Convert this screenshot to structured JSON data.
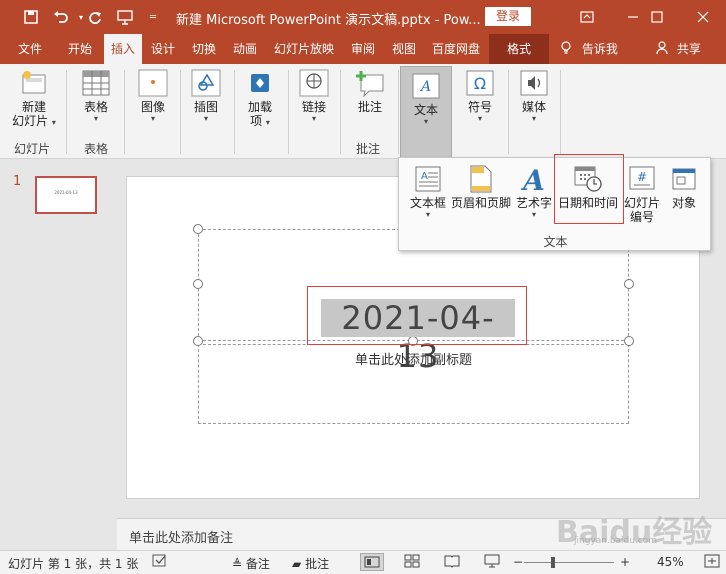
{
  "titlebar": {
    "title": "新建 Microsoft PowerPoint 演示文稿.pptx  -  Pow...",
    "login": "登录",
    "icons": [
      "save-icon",
      "undo-icon",
      "redo-icon",
      "presenter-icon",
      "customize-icon"
    ]
  },
  "menu": {
    "tabs": [
      "文件",
      "开始",
      "插入",
      "设计",
      "切换",
      "动画",
      "幻灯片放映",
      "审阅",
      "视图",
      "百度网盘",
      "格式"
    ],
    "active": "插入",
    "tell_me": "告诉我",
    "share": "共享"
  },
  "ribbon": {
    "new_slide_line1": "新建",
    "new_slide_line2": "幻灯片",
    "table": "表格",
    "image": "图像",
    "illustrations": "插图",
    "addins_line1": "加载",
    "addins_line2": "项",
    "link": "链接",
    "comment": "批注",
    "text": "文本",
    "symbols": "符号",
    "media": "媒体",
    "groups": {
      "slides": "幻灯片",
      "tables": "表格",
      "comments": "批注"
    }
  },
  "dropdown": {
    "textbox": "文本框",
    "header_footer": "页眉和页脚",
    "wordart": "艺术字",
    "datetime": "日期和时间",
    "slide_number_line1": "幻灯片",
    "slide_number_line2": "编号",
    "object": "对象",
    "group_label": "文本"
  },
  "thumbnails": {
    "number": "1"
  },
  "slide": {
    "date_text": "2021-04-13",
    "subtitle_placeholder": "单击此处添加副标题"
  },
  "notes": {
    "placeholder": "单击此处添加备注"
  },
  "statusbar": {
    "slide_info": "幻灯片 第 1 张，共 1 张",
    "notes": "备注",
    "comments": "批注",
    "zoom": "45%",
    "minus": "−",
    "plus": "+"
  },
  "watermark": {
    "text": "Baidu经验",
    "url": "jingyan.baidu.com"
  },
  "colors": {
    "accent": "#b7472a",
    "highlight_box": "#e0403a"
  }
}
